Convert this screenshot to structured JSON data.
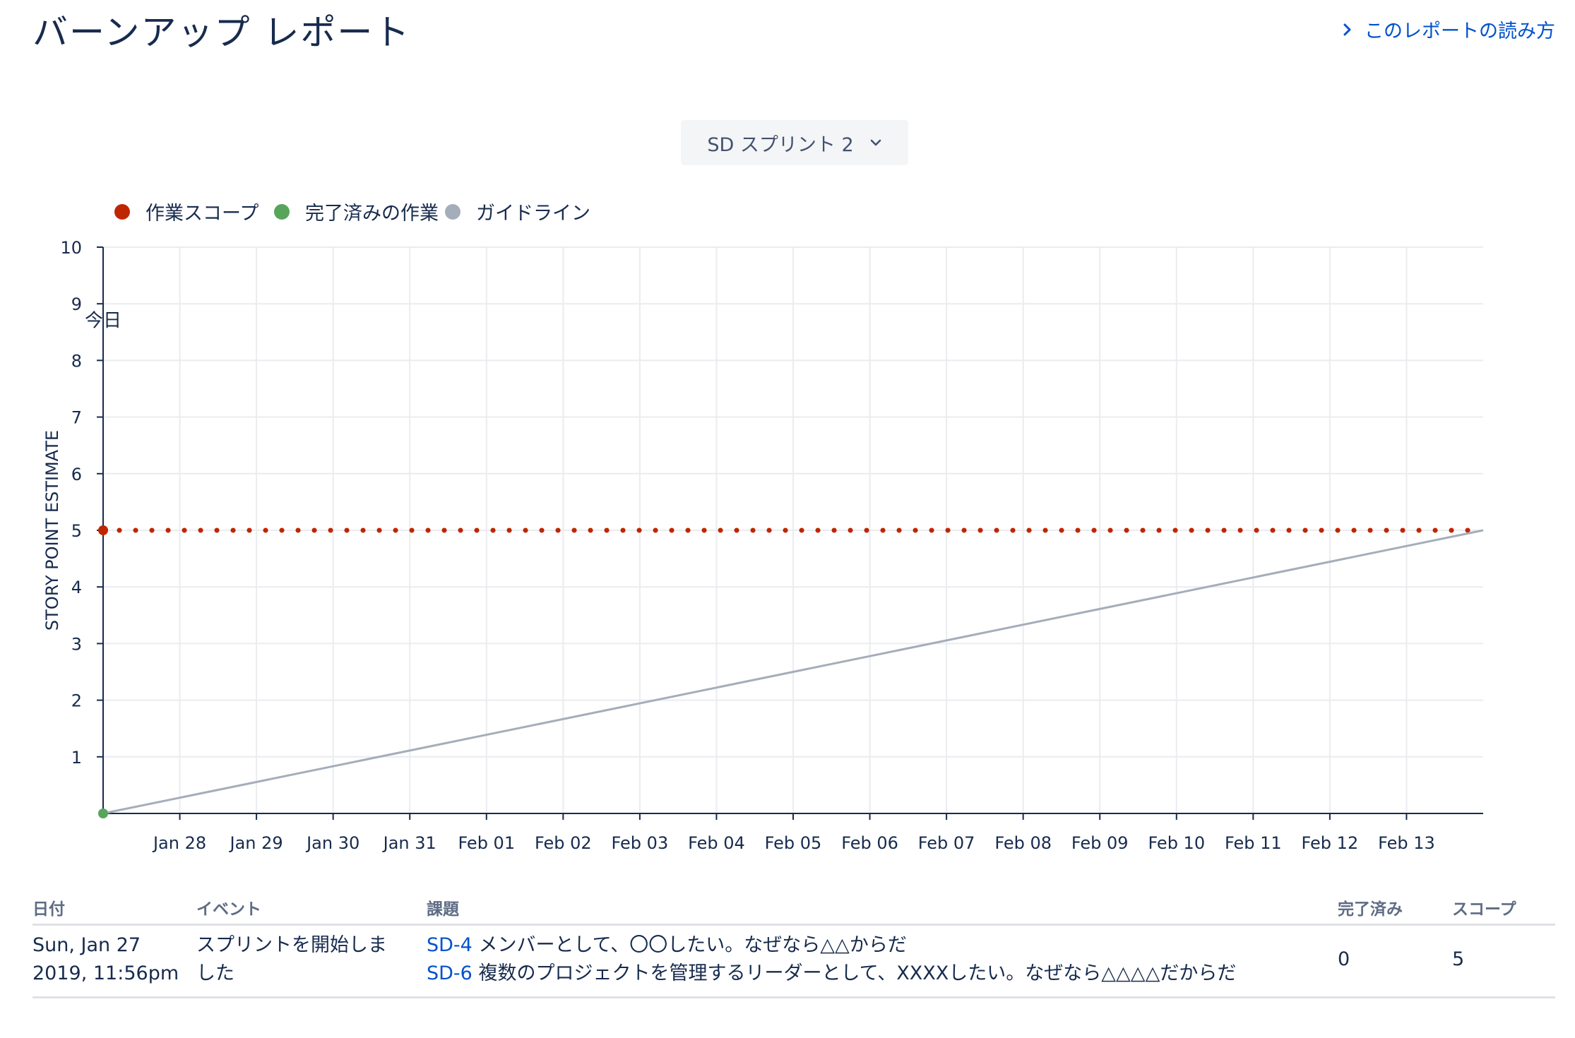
{
  "header": {
    "title": "バーンアップ レポート",
    "help_link_label": "このレポートの読み方"
  },
  "sprint_selector": {
    "selected": "SD スプリント 2"
  },
  "colors": {
    "scope": "#BF2600",
    "completed": "#57A55A",
    "guideline": "#A5ADBA",
    "axis": "#172B4D",
    "grid": "#EBECF0",
    "link": "#0052CC"
  },
  "chart_data": {
    "type": "line",
    "ylabel": "STORY POINT ESTIMATE",
    "ylim": [
      0,
      10
    ],
    "yticks": [
      "1",
      "2",
      "3",
      "4",
      "5",
      "6",
      "7",
      "8",
      "9",
      "10"
    ],
    "x_range": [
      "Jan 27",
      "Feb 14"
    ],
    "xticks": [
      "Jan 28",
      "Jan 29",
      "Jan 30",
      "Jan 31",
      "Feb 01",
      "Feb 02",
      "Feb 03",
      "Feb 04",
      "Feb 05",
      "Feb 06",
      "Feb 07",
      "Feb 08",
      "Feb 09",
      "Feb 10",
      "Feb 11",
      "Feb 12",
      "Feb 13"
    ],
    "today_label": "今日",
    "today_x": "Jan 27",
    "grid": true,
    "legend_position": "top-left",
    "series": [
      {
        "name": "作業スコープ",
        "color": "#BF2600",
        "style": "dotted",
        "points": [
          [
            "Jan 27",
            5
          ],
          [
            "Feb 14",
            5
          ]
        ]
      },
      {
        "name": "完了済みの作業",
        "color": "#57A55A",
        "style": "solid",
        "points": [
          [
            "Jan 27",
            0
          ]
        ]
      },
      {
        "name": "ガイドライン",
        "color": "#A5ADBA",
        "style": "solid",
        "points": [
          [
            "Jan 27",
            0
          ],
          [
            "Feb 14",
            5
          ]
        ]
      }
    ]
  },
  "table": {
    "headers": {
      "date": "日付",
      "event": "イベント",
      "issues": "課題",
      "completed": "完了済み",
      "scope": "スコープ"
    },
    "rows": [
      {
        "date_line1": "Sun, Jan 27",
        "date_line2": "2019, 11:56pm",
        "event_line1": "スプリントを開始しま",
        "event_line2": "した",
        "issues": [
          {
            "key": "SD-4",
            "summary": "メンバーとして、〇〇したい。なぜなら△△からだ"
          },
          {
            "key": "SD-6",
            "summary": "複数のプロジェクトを管理するリーダーとして、XXXXしたい。なぜなら△△△△だからだ"
          }
        ],
        "completed": "0",
        "scope": "5"
      }
    ]
  }
}
